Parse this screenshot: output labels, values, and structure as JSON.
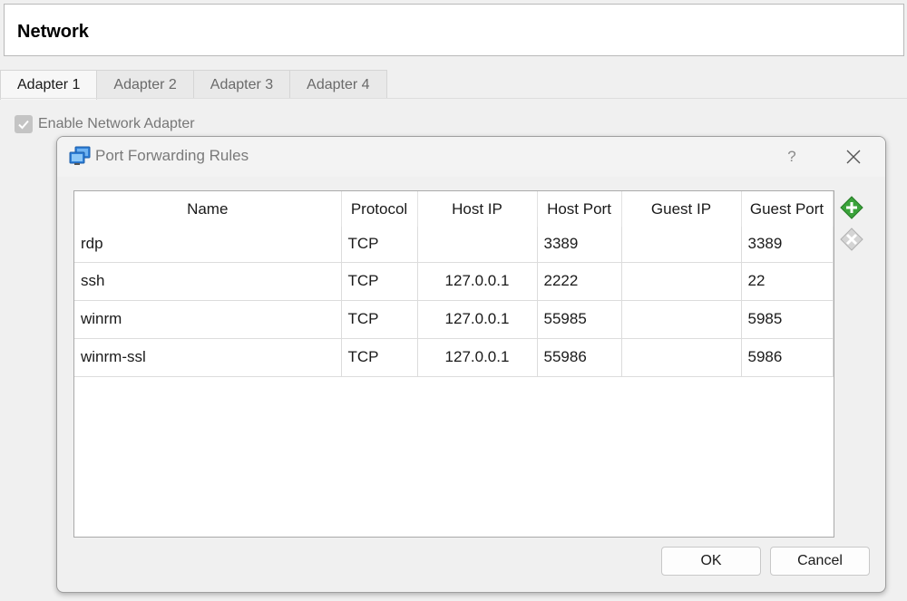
{
  "page": {
    "title": "Network",
    "tabs": [
      "Adapter 1",
      "Adapter 2",
      "Adapter 3",
      "Adapter 4"
    ],
    "active_tab": 0,
    "enable_adapter": {
      "label": "Enable Network Adapter",
      "checked": true
    }
  },
  "dialog": {
    "title": "Port Forwarding Rules",
    "help_label": "?",
    "columns": [
      "Name",
      "Protocol",
      "Host IP",
      "Host Port",
      "Guest IP",
      "Guest Port"
    ],
    "rows": [
      [
        "rdp",
        "TCP",
        "",
        "3389",
        "",
        "3389"
      ],
      [
        "ssh",
        "TCP",
        "127.0.0.1",
        "2222",
        "",
        "22"
      ],
      [
        "winrm",
        "TCP",
        "127.0.0.1",
        "55985",
        "",
        "5985"
      ],
      [
        "winrm-ssl",
        "TCP",
        "127.0.0.1",
        "55986",
        "",
        "5986"
      ]
    ],
    "ok_label": "OK",
    "cancel_label": "Cancel",
    "icons": {
      "title": "network-adapter-icon",
      "add": "add-rule-icon",
      "remove": "remove-rule-icon",
      "close": "close-icon"
    },
    "colors": {
      "add_icon": "#3aa23a",
      "remove_icon": "#c8c8c8",
      "title_icon": "#2f7fd8"
    }
  }
}
